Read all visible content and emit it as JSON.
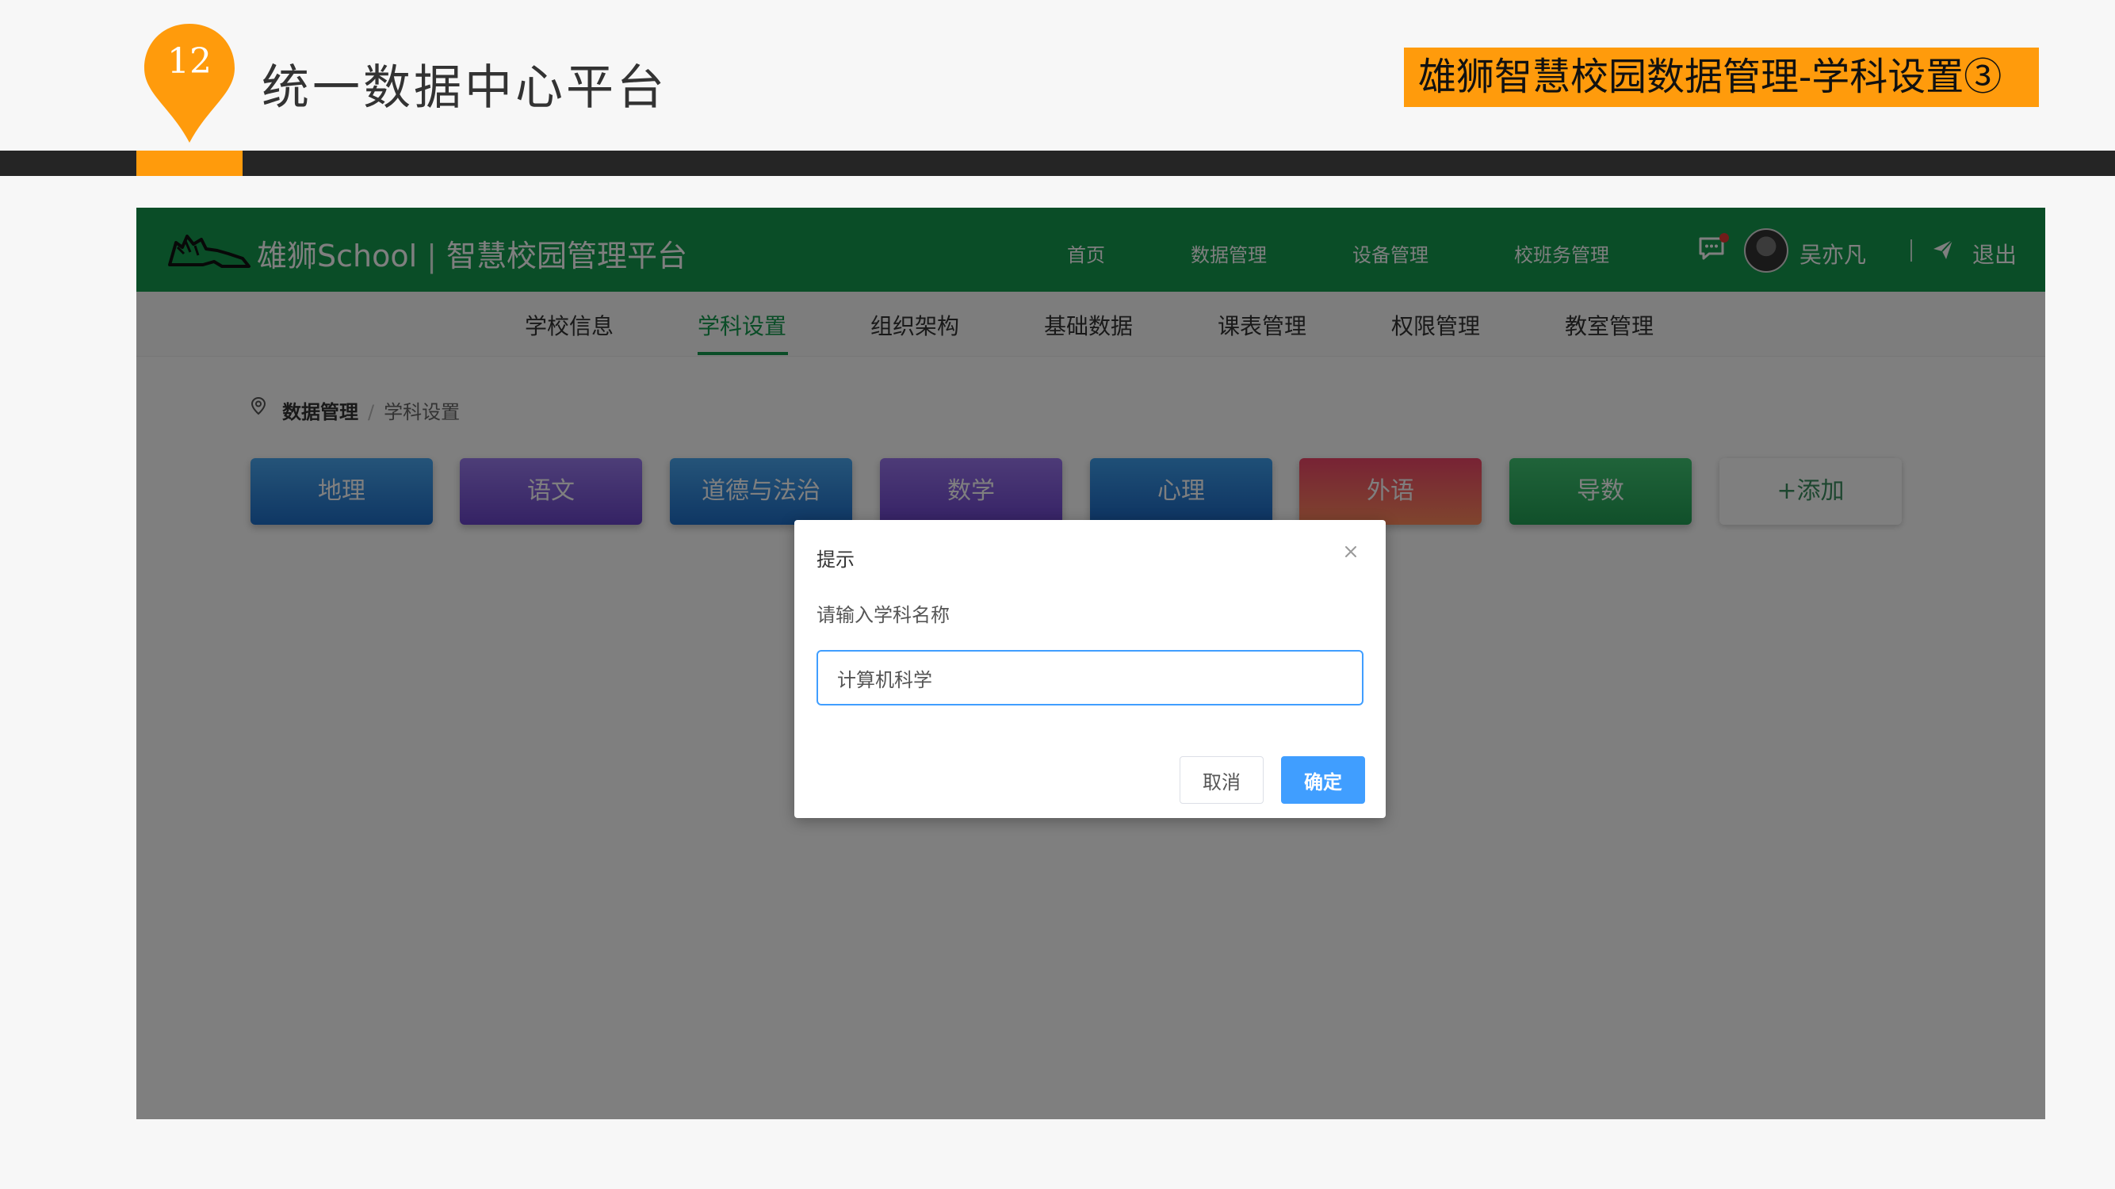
{
  "slide": {
    "number": "12",
    "title": "统一数据中心平台",
    "badge": "雄狮智慧校园数据管理-学科设置③"
  },
  "app": {
    "brand_name": "雄狮School",
    "brand_separator": "|",
    "brand_subtitle": "智慧校园管理平台",
    "top_nav": [
      "首页",
      "数据管理",
      "设备管理",
      "校班务管理"
    ],
    "user_name": "吴亦凡",
    "logout_label": "退出",
    "sub_nav": [
      "学校信息",
      "学科设置",
      "组织架构",
      "基础数据",
      "课表管理",
      "权限管理",
      "教室管理"
    ],
    "active_sub_nav": "学科设置",
    "breadcrumb": {
      "parent": "数据管理",
      "separator": "/",
      "current": "学科设置"
    },
    "subjects": [
      "地理",
      "语文",
      "道德与法治",
      "数学",
      "心理",
      "外语",
      "导数"
    ],
    "add_subject_label": "+添加"
  },
  "dialog": {
    "title": "提示",
    "message": "请输入学科名称",
    "input_value": "计算机科学",
    "cancel_label": "取消",
    "confirm_label": "确定"
  },
  "colors": {
    "brand_green": "#149a4f",
    "accent_orange": "#ff9b0c",
    "primary_blue": "#409eff"
  }
}
